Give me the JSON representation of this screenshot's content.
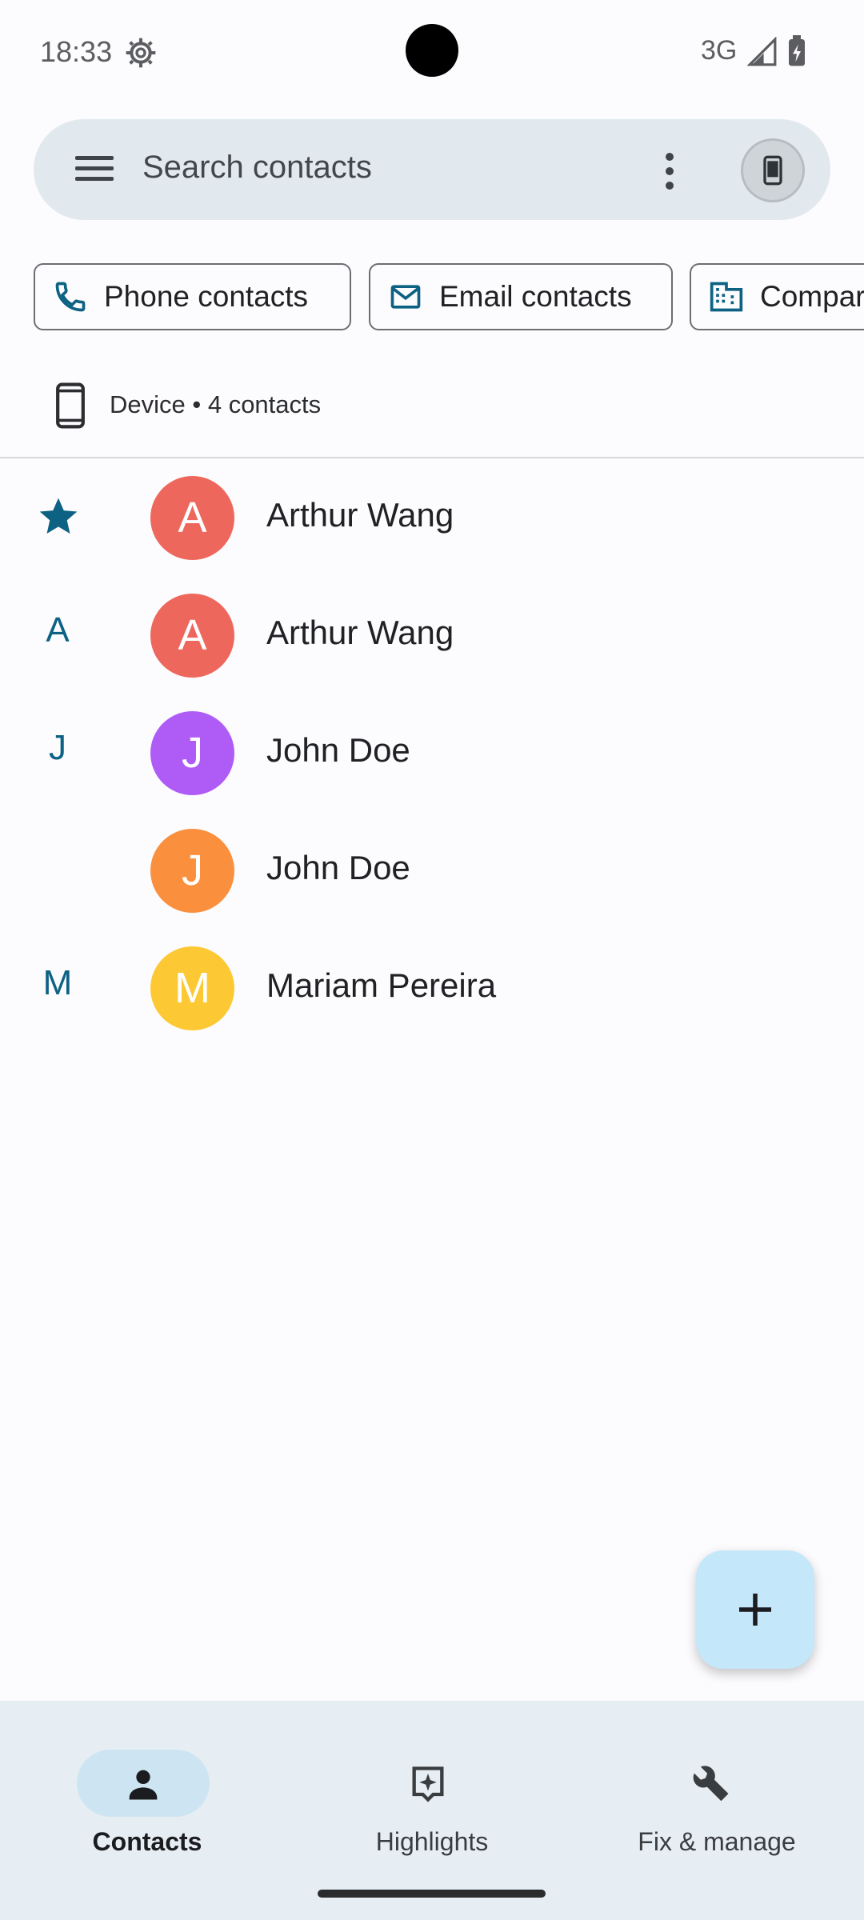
{
  "status_bar": {
    "time": "18:33",
    "network": "3G",
    "icons": [
      "settings-gear-icon",
      "signal-icon",
      "battery-charging-icon"
    ]
  },
  "search": {
    "placeholder": "Search contacts",
    "menu_icon": "menu-icon",
    "more_icon": "more-vert-icon",
    "account_icon": "phone-device-icon"
  },
  "filters": [
    {
      "label": "Phone contacts",
      "icon": "phone-icon"
    },
    {
      "label": "Email contacts",
      "icon": "mail-icon"
    },
    {
      "label": "Compar",
      "icon": "company-icon"
    }
  ],
  "account": {
    "label": "Device • 4 contacts",
    "icon": "smartphone-icon"
  },
  "contacts": [
    {
      "section": "★",
      "name": "Arthur Wang",
      "initial": "A",
      "color": "#ee675c"
    },
    {
      "section": "A",
      "name": "Arthur Wang",
      "initial": "A",
      "color": "#ee675c"
    },
    {
      "section": "J",
      "name": "John Doe",
      "initial": "J",
      "color": "#af5cf7"
    },
    {
      "section": "",
      "name": "John Doe",
      "initial": "J",
      "color": "#fa903e"
    },
    {
      "section": "M",
      "name": "Mariam Pereira",
      "initial": "M",
      "color": "#fcc934"
    }
  ],
  "fab": {
    "icon": "add-icon"
  },
  "nav": [
    {
      "label": "Contacts",
      "icon": "person-icon",
      "active": true
    },
    {
      "label": "Highlights",
      "icon": "highlights-icon",
      "active": false
    },
    {
      "label": "Fix & manage",
      "icon": "wrench-icon",
      "active": false
    }
  ],
  "colors": {
    "accent": "#0d6283",
    "search_bg": "#e1e9ef",
    "nav_bg": "#e7eef3",
    "fab_bg": "#c4e7fa"
  }
}
